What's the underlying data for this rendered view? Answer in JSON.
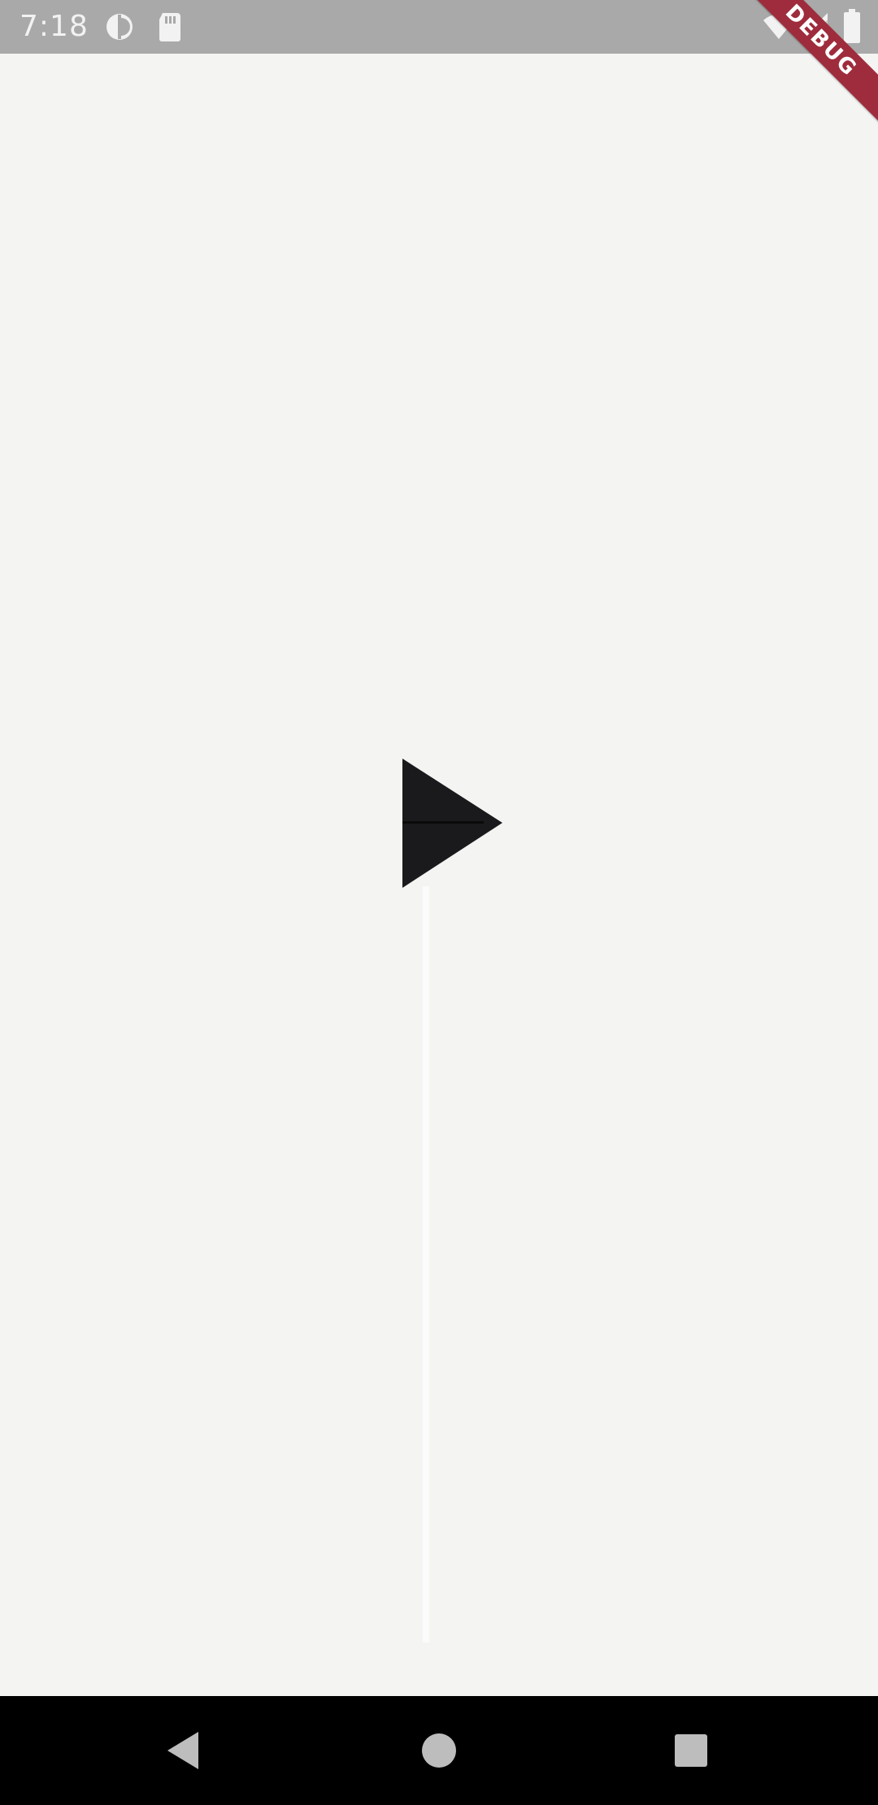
{
  "status_bar": {
    "time": "7:18",
    "debug_label": "DEBUG",
    "icons": [
      "sync-icon",
      "sim-card-icon",
      "wifi-icon",
      "signal-icon",
      "battery-icon"
    ]
  },
  "main": {
    "play_button_icon": "play-icon"
  },
  "nav_bar": {
    "buttons": [
      "back-icon",
      "home-icon",
      "recents-icon"
    ]
  },
  "colors": {
    "status_bar": "#a9a9a9",
    "background": "#f4f4f3",
    "play_icon": "#1a1a1c",
    "debug_banner": "#9e2c3c",
    "nav_bar": "#000000",
    "nav_icon": "#bdbdbd"
  }
}
